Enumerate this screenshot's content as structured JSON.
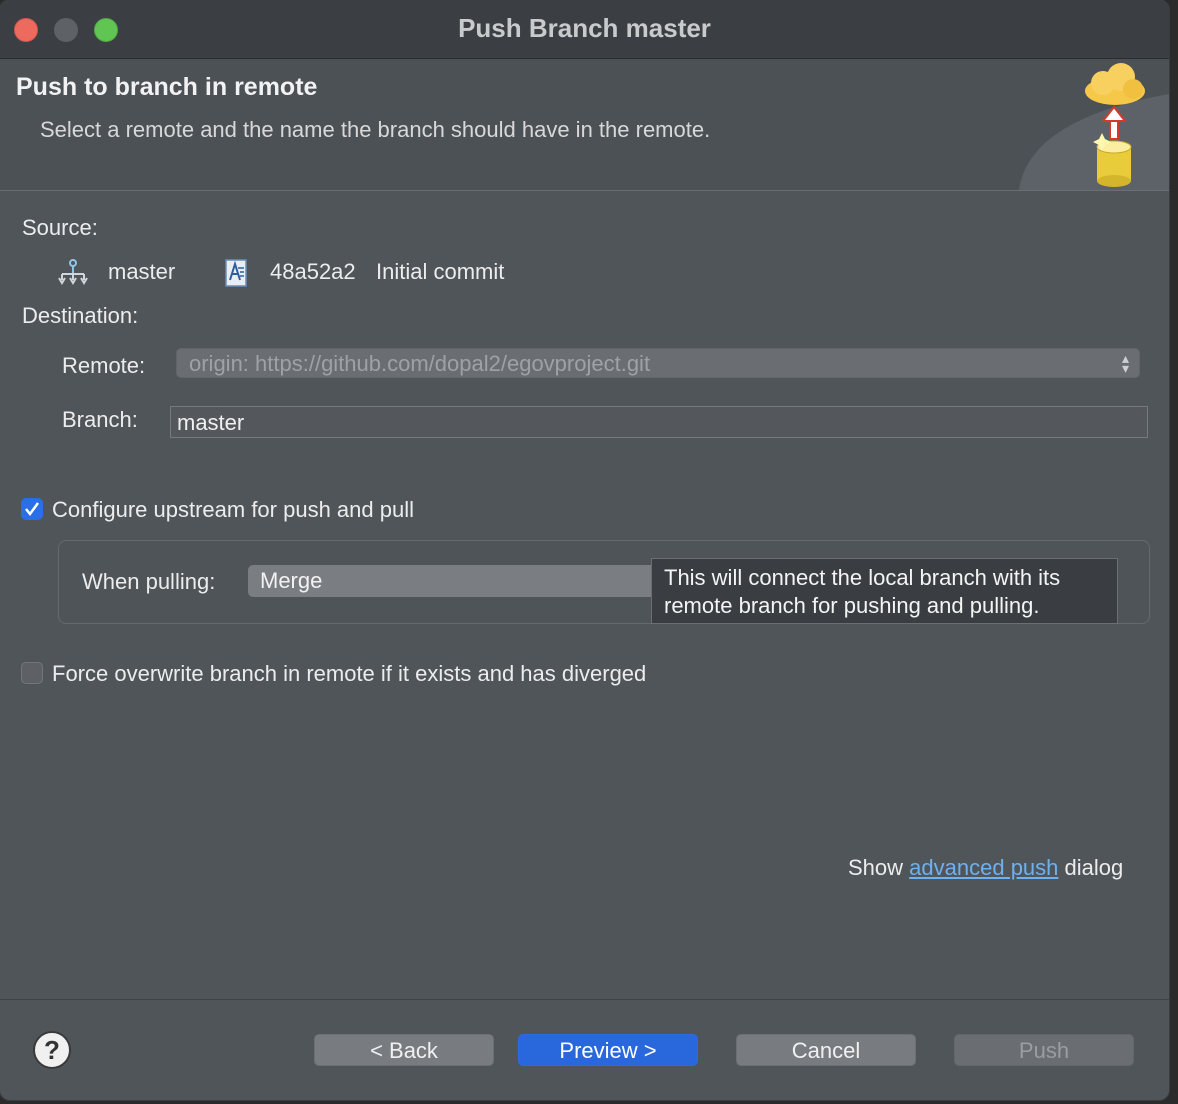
{
  "window": {
    "title": "Push Branch master"
  },
  "banner": {
    "title": "Push to branch in remote",
    "description": "Select a remote and the name the branch should have in the remote."
  },
  "source": {
    "label": "Source:",
    "branch": "master",
    "commit_id": "48a52a2",
    "commit_message": "Initial commit"
  },
  "destination": {
    "label": "Destination:",
    "remote_label": "Remote:",
    "remote_value": "origin: https://github.com/dopal2/egovproject.git",
    "branch_label": "Branch:",
    "branch_value": "master"
  },
  "upstream": {
    "checkbox_label": "Configure upstream for push and pull",
    "checked": true,
    "when_pulling_label": "When pulling:",
    "when_pulling_value": "Merge",
    "tooltip": "This will connect the local branch with its remote branch for pushing and pulling."
  },
  "force": {
    "checkbox_label": "Force overwrite branch in remote if it exists and has diverged",
    "checked": false
  },
  "advanced": {
    "prefix": "Show",
    "link": "advanced push",
    "suffix": "dialog"
  },
  "buttons": {
    "help": "?",
    "back": "< Back",
    "preview": "Preview >",
    "cancel": "Cancel",
    "push": "Push"
  },
  "colors": {
    "accent": "#2967dc",
    "link": "#6fb0ee",
    "background": "#50555a"
  }
}
